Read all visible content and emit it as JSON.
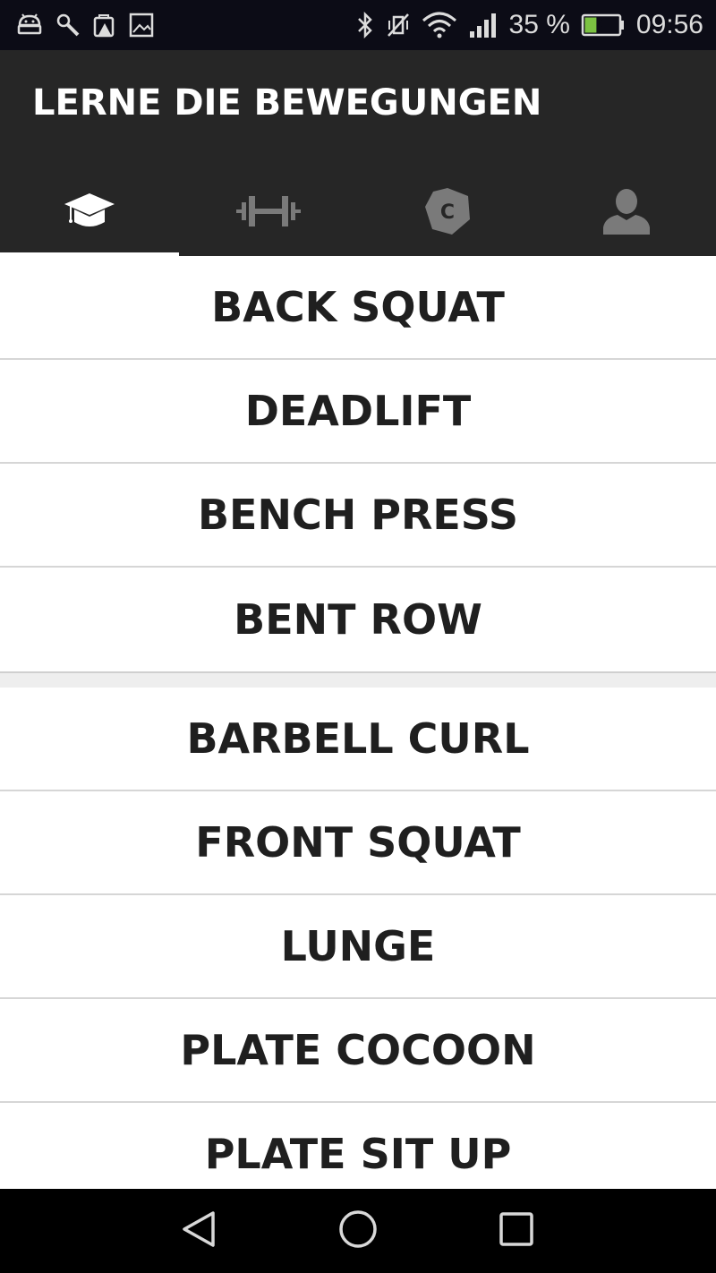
{
  "status_bar": {
    "left_icons": [
      "android-debug-icon",
      "wrench-icon",
      "warning-bag-icon",
      "image-icon"
    ],
    "right_icons": [
      "bluetooth-icon",
      "vibrate-off-icon",
      "wifi-icon",
      "signal-icon"
    ],
    "battery_percent": "35 %",
    "battery_level": 0.35,
    "time": "09:56"
  },
  "app_bar": {
    "title": "LERNE DIE BEWEGUNGEN",
    "tabs": [
      {
        "icon": "graduation-cap-icon",
        "active": true
      },
      {
        "icon": "dumbbell-icon",
        "active": false
      },
      {
        "icon": "hexagon-c-icon",
        "active": false,
        "badge_letter": "C"
      },
      {
        "icon": "profile-icon",
        "active": false
      }
    ]
  },
  "exercises": {
    "group_1": [
      "BACK SQUAT",
      "DEADLIFT",
      "BENCH PRESS",
      "BENT ROW"
    ],
    "group_2": [
      "BARBELL CURL",
      "FRONT SQUAT",
      "LUNGE",
      "PLATE COCOON",
      "PLATE SIT UP"
    ]
  },
  "nav_bar": {
    "buttons": [
      "back-icon",
      "home-icon",
      "recents-icon"
    ]
  },
  "colors": {
    "status_bar_bg": "#0c0c16",
    "app_bar_bg": "#262626",
    "active_tab_icon": "#ffffff",
    "inactive_tab_icon": "#7a7a7a",
    "battery_fill": "#7cc242",
    "row_text": "#1f1f1f"
  }
}
